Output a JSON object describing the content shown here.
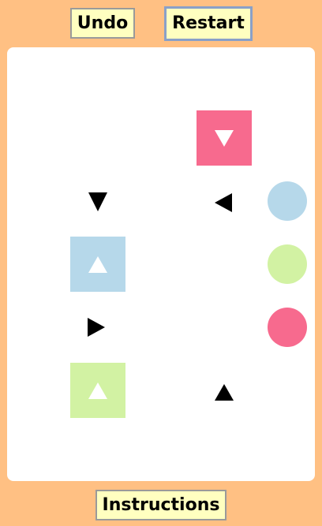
{
  "toolbar": {
    "undo_label": "Undo",
    "restart_label": "Restart",
    "instructions_label": "Instructions"
  },
  "colors": {
    "pink": "#F76A8E",
    "blue": "#B6D8EA",
    "green": "#D2F2A3",
    "arrow": "#000000"
  },
  "blocks": [
    {
      "color": "pink",
      "direction": "down"
    },
    {
      "color": "blue",
      "direction": "up"
    },
    {
      "color": "green",
      "direction": "up"
    }
  ],
  "arrows": [
    "down",
    "left",
    "right",
    "up"
  ],
  "goals": [
    "blue",
    "green",
    "pink"
  ]
}
